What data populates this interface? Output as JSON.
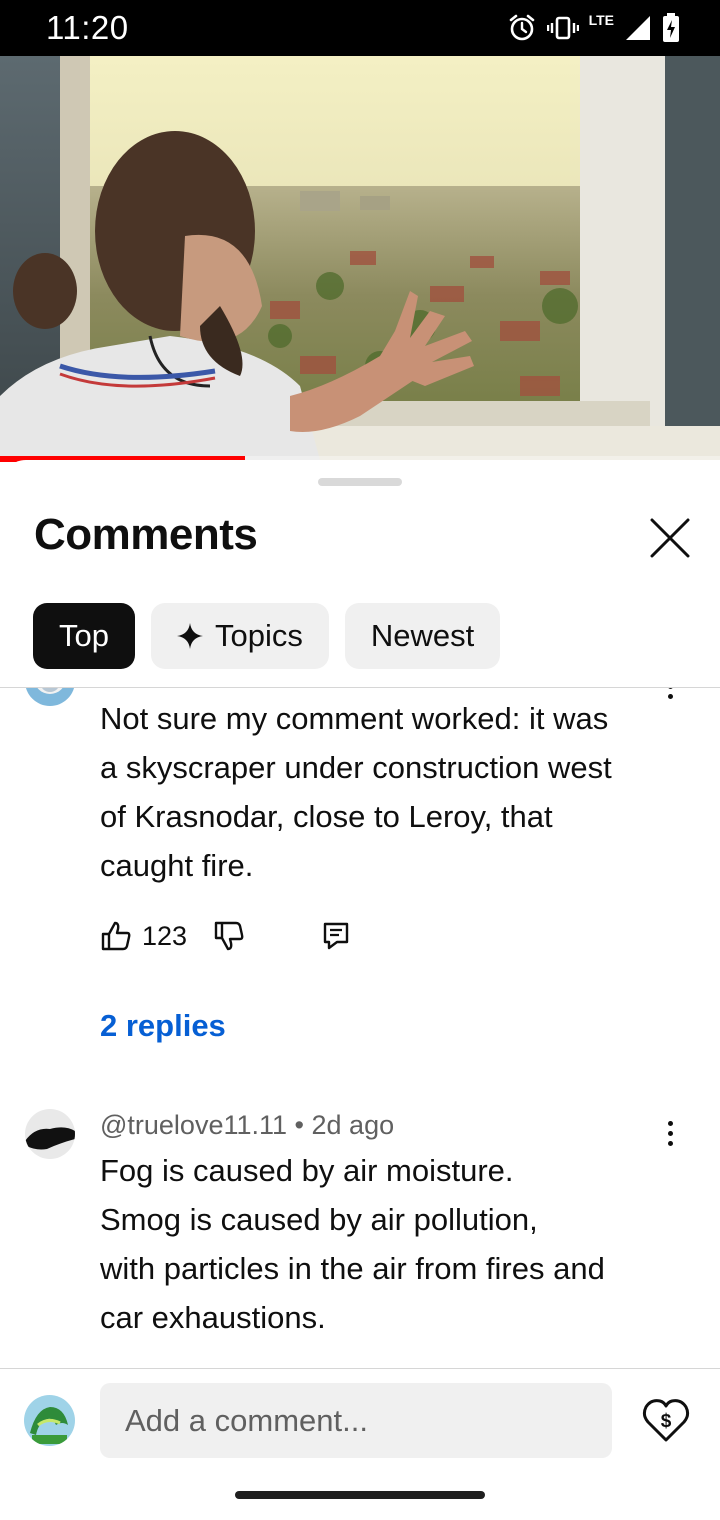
{
  "status_bar": {
    "time": "11:20",
    "network_label": "LTE",
    "icons": [
      "alarm-icon",
      "vibrate-icon",
      "signal-icon",
      "battery-charging-icon"
    ]
  },
  "video": {
    "progress_fraction": 0.34
  },
  "panel": {
    "title": "Comments",
    "chips": [
      {
        "label": "Top",
        "active": true
      },
      {
        "label": "Topics",
        "icon": "sparkle-icon",
        "active": false
      },
      {
        "label": "Newest",
        "active": false
      }
    ]
  },
  "comments": [
    {
      "text_lines": [
        "Not sure my comment worked: it was",
        "a skyscraper under construction west",
        "of Krasnodar, close to Leroy, that",
        "caught fire."
      ],
      "likes": "123",
      "replies_label": "2 replies"
    },
    {
      "author": "@truelove11.11",
      "separator": "•",
      "age": "2d ago",
      "text_lines": [
        "Fog is caused by air moisture.",
        "Smog is caused by air pollution,",
        "with particles in the air from fires and",
        "car exhaustions."
      ]
    }
  ],
  "composer": {
    "placeholder": "Add a comment..."
  },
  "colors": {
    "accent_blue": "#065fd4",
    "progress_red": "#ff0000",
    "chip_active_bg": "#0f0f0f",
    "chip_bg": "#f0f0f0"
  }
}
